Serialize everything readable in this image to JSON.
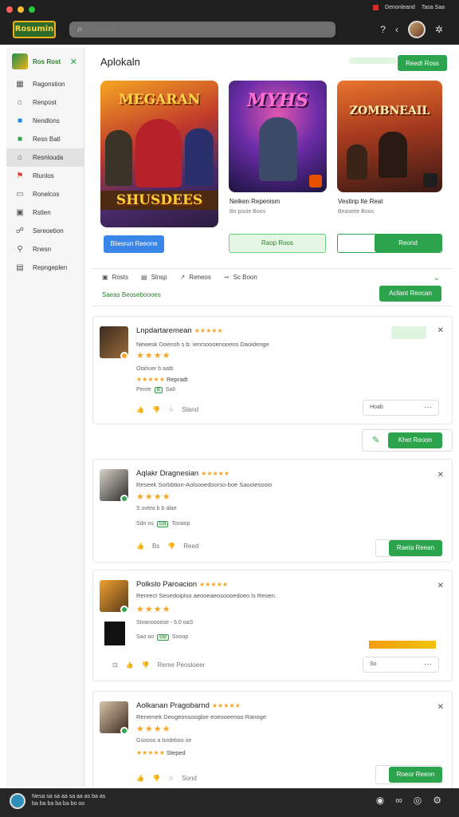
{
  "app": {
    "logo_text": "Rosumin",
    "search_placeholder": "Uaconn",
    "titlebar_right": [
      "Denonleand",
      "Tasa Saa"
    ]
  },
  "sidebar": {
    "header": "Ros Rost",
    "items": [
      {
        "label": "Ragonstion",
        "icon": "grid-icon"
      },
      {
        "label": "Renpost",
        "icon": "building-icon"
      },
      {
        "label": "Nendlons",
        "icon": "square-blue-icon"
      },
      {
        "label": "Resn Batl",
        "icon": "square-green-icon"
      },
      {
        "label": "Resnlouda",
        "icon": "shop-icon",
        "active": true
      },
      {
        "label": "Rlunlos",
        "icon": "flag-icon"
      },
      {
        "label": "Ronelcos",
        "icon": "chat-icon"
      },
      {
        "label": "Rstlen",
        "icon": "image-icon"
      },
      {
        "label": "Sereoetion",
        "icon": "users-icon"
      },
      {
        "label": "Rnesn",
        "icon": "pin-icon"
      },
      {
        "label": "Repngeplen",
        "icon": "doc-icon"
      }
    ]
  },
  "featured": {
    "title": "Aplokaln",
    "action_label": "Reedt Ross",
    "games": [
      {
        "poster_title": "MEGARAN",
        "poster_sub": "SHUSDEES",
        "name": "",
        "sub": "",
        "button": "Bliesrun Reeone"
      },
      {
        "poster_title": "MYHS",
        "poster_sub": "",
        "name": "Neiken Repenism",
        "sub": "Bo psoie Boos",
        "button": "Raop Roos"
      },
      {
        "poster_title": "ZOMBNEAIL",
        "poster_sub": "",
        "name": "Vestinp Ite Reat",
        "sub": "Beaseite Boos",
        "button": "Reond"
      }
    ]
  },
  "tabs": [
    {
      "icon": "box-icon",
      "label": "Rosts"
    },
    {
      "icon": "layers-icon",
      "label": "Slnsp"
    },
    {
      "icon": "arrow-icon",
      "label": "Reneos"
    },
    {
      "icon": "link-icon",
      "label": "Sc Boon"
    }
  ],
  "status_text": "Saeas Beoseboooes",
  "status_button": "Acllant Reocan",
  "reviews": [
    {
      "title": "Lnpdartaremean",
      "title_stars": "★★★★★",
      "text": "Newesk Doensh s b: ienrsoooenooens Daoidenge",
      "stars": "★★★★",
      "meta": "Otahuer b aatb",
      "rating_stars": "★★★★★",
      "rating_label": "Repradt",
      "tag_line": [
        "Penre",
        "B",
        "Sa6"
      ],
      "actions": [
        "",
        "",
        "Stand"
      ],
      "pill": "Hoab",
      "dots": "···"
    },
    {
      "title": "Aqlakr Dragnesian",
      "title_stars": "★★★★★",
      "text": "Reseek Sorbbtion-Aolsooedoorso-boe Saooiesooin",
      "stars": "★★★★",
      "meta": "S ovtea b b alae",
      "tag_line": [
        "Sdn os",
        "GB",
        "Tooaop"
      ],
      "actions": [
        "Bs",
        "",
        "Reed"
      ],
      "button": "Raeta Reean"
    },
    {
      "title": "Polkslo Paroacion",
      "title_stars": "★★★★★",
      "text": "Renrect Seoedoiplso aeooeaeosoooedoeo ls Reoen.",
      "stars": "★★★★",
      "meta": "Stvanoooose - 6.0 oaS",
      "tag_line": [
        "Sao oo",
        "GB",
        "Sooop"
      ],
      "actions": [
        "",
        "",
        "Reme Peosloeer"
      ],
      "pill": "So",
      "dots": "···"
    },
    {
      "title": "Aolkanan Pragobarnd",
      "title_stars": "★★★★★",
      "text": "Renemek Deogeonsoogloe eoeooeenoo Ranoge",
      "stars": "★★★★",
      "meta": "Gsoooo a bodeboo oe",
      "rating_stars": "★★★★★",
      "rating_label": "Steped",
      "actions": [
        "",
        "",
        "Sond"
      ],
      "button": "Roeor Reeon"
    }
  ],
  "floating_button": "Khet Reoon",
  "footer": {
    "line1": "Nesa sa sa aa sa aa as ba as",
    "line2": "ba ba ba ba ba bo oo"
  }
}
